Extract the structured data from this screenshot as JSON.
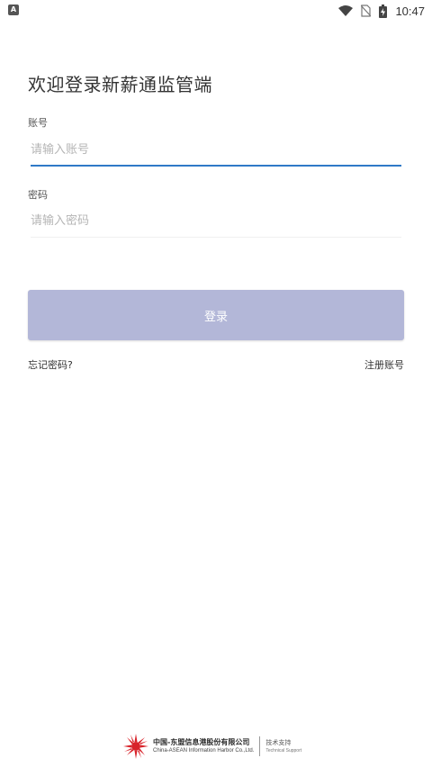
{
  "status_bar": {
    "app_icon_letter": "A",
    "time": "10:47"
  },
  "login": {
    "welcome_title": "欢迎登录新薪通监管端",
    "account_label": "账号",
    "account_placeholder": "请输入账号",
    "account_value": "",
    "password_label": "密码",
    "password_placeholder": "请输入密码",
    "password_value": "",
    "login_button": "登录",
    "forgot_password": "忘记密码?",
    "register_account": "注册账号"
  },
  "footer": {
    "company_cn": "中国-东盟信息港股份有限公司",
    "company_en": "China-ASEAN Information Harbor Co.,Ltd.",
    "support_cn": "技术支持",
    "support_en": "Technical Support"
  },
  "colors": {
    "accent_underline": "#2f79c7",
    "button_bg": "#b3b7d8",
    "logo_red": "#d8232a"
  }
}
